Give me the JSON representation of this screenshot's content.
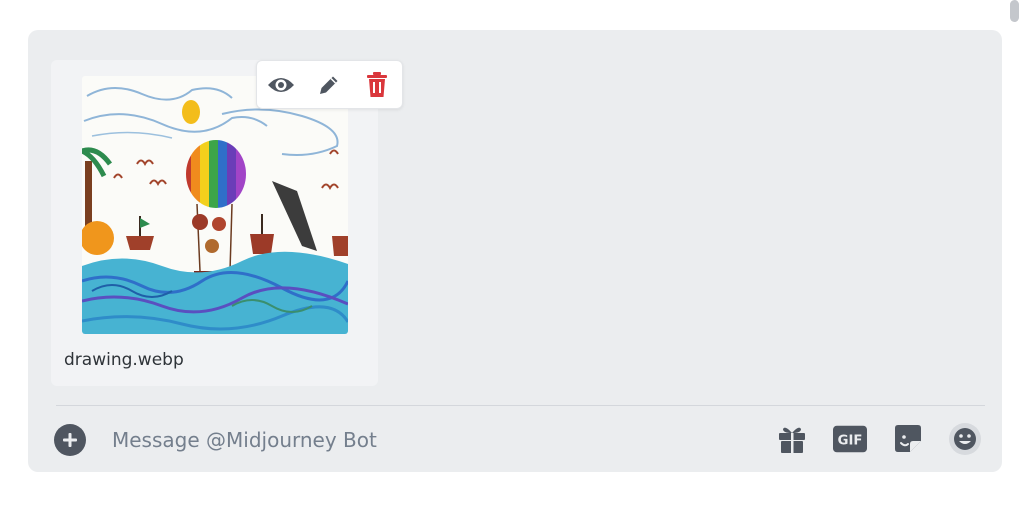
{
  "attachment": {
    "file_name": "drawing.webp",
    "thumbnail_icon": "child-drawing-thumbnail",
    "actions": [
      {
        "name": "view-attachment-button",
        "icon": "eye-icon",
        "color": "#4f5660"
      },
      {
        "name": "edit-attachment-button",
        "icon": "pencil-icon",
        "color": "#4f5660"
      },
      {
        "name": "remove-attachment-button",
        "icon": "trash-icon",
        "color": "#da373c"
      }
    ]
  },
  "composer": {
    "placeholder": "Message @Midjourney Bot",
    "value": "",
    "upload_icon": "plus-circle-icon",
    "tools": [
      {
        "name": "gift-button",
        "icon": "gift-icon"
      },
      {
        "name": "gif-button",
        "icon": "gif-icon",
        "label": "GIF"
      },
      {
        "name": "sticker-button",
        "icon": "sticker-icon"
      },
      {
        "name": "emoji-button",
        "icon": "emoji-icon"
      }
    ]
  },
  "colors": {
    "composer_bg": "#ebedef",
    "icon_gray": "#4f5660",
    "danger": "#da373c",
    "placeholder": "#747f8d"
  }
}
